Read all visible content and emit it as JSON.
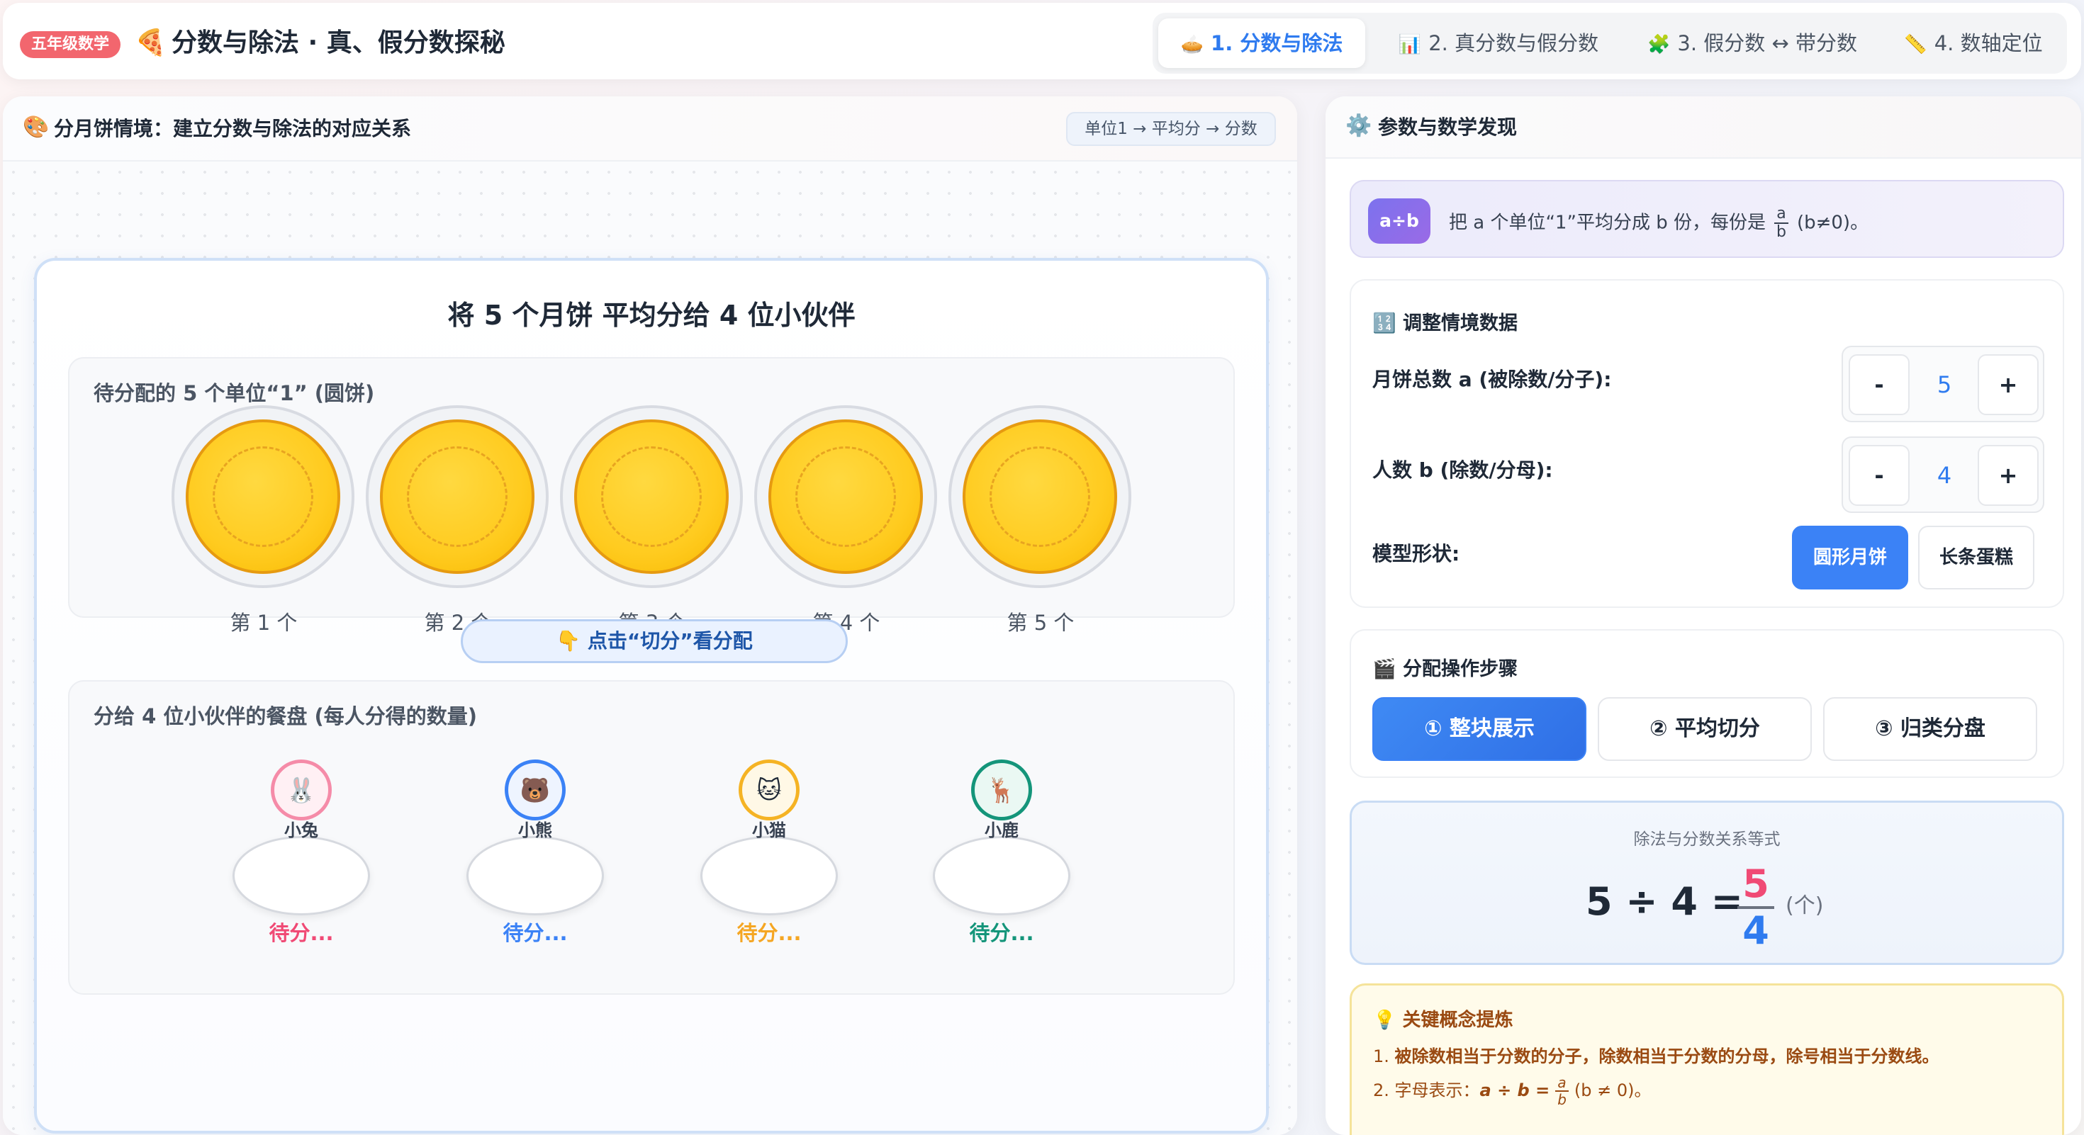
{
  "header": {
    "grade_badge": "五年级数学",
    "title_icon": "pizza-icon",
    "title": "分数与除法 · 真、假分数探秘",
    "tabs": [
      {
        "icon": "🥧",
        "label": "1. 分数与除法",
        "active": true
      },
      {
        "icon": "📊",
        "label": "2. 真分数与假分数",
        "active": false
      },
      {
        "icon": "🧩",
        "label": "3. 假分数 ↔ 带分数",
        "active": false
      },
      {
        "icon": "📏",
        "label": "4. 数轴定位",
        "active": false
      }
    ]
  },
  "scene": {
    "header_icon": "palette-icon",
    "header_title": "分月饼情境：建立分数与除法的对应关系",
    "flow_chip": "单位1 → 平均分 → 分数",
    "title": "将 5 个月饼 平均分给 4 位小伙伴",
    "pool_label": "待分配的 5 个单位“1” (圆饼)",
    "cakes": [
      "第 1 个",
      "第 2 个",
      "第 3 个",
      "第 4 个",
      "第 5 个"
    ],
    "cut_button": "👇 点击“切分”看分配",
    "plates_label": "分给 4 位小伙伴的餐盘 (每人分得的数量)",
    "friends": [
      {
        "emoji": "🐰",
        "name": "小兔",
        "status": "待分...",
        "color": "#f04a75"
      },
      {
        "emoji": "🐻",
        "name": "小熊",
        "status": "待分...",
        "color": "#3b82f6"
      },
      {
        "emoji": "🐱",
        "name": "小猫",
        "status": "待分...",
        "color": "#f5a623"
      },
      {
        "emoji": "🦌",
        "name": "小鹿",
        "status": "待分...",
        "color": "#14957a"
      }
    ]
  },
  "panel": {
    "header_icon": "gear-icon",
    "header_title": "参数与数学发现",
    "rule_badge": "a÷b",
    "rule_prefix": "把 a 个单位“1”平均分成 b 份，每份是",
    "rule_frac_num": "a",
    "rule_frac_den": "b",
    "rule_suffix": "(b≠0)。",
    "adjust_icon": "🔢",
    "adjust_title": "调整情境数据",
    "total_label": "月饼总数 a (被除数/分子):",
    "total_value": "5",
    "people_label": "人数 b (除数/分母):",
    "people_value": "4",
    "minus": "-",
    "plus": "+",
    "shape_label": "模型形状:",
    "shape_options": [
      "圆形月饼",
      "长条蛋糕"
    ],
    "steps_icon": "🎬",
    "steps_title": "分配操作步骤",
    "steps": [
      "① 整块展示",
      "② 平均切分",
      "③ 归类分盘"
    ],
    "equation": {
      "caption": "除法与分数关系等式",
      "lhs": "5 ÷ 4 =",
      "numerator": "5",
      "denominator": "4",
      "unit": "(个)"
    },
    "concept": {
      "icon": "💡",
      "title": "关键概念提炼",
      "line1_prefix": "1. ",
      "line1": "被除数相当于分数的分子，除数相当于分数的分母，除号相当于分数线。",
      "line2_prefix": "2. 字母表示：",
      "line2_expr": "a ÷ b =",
      "line2_num": "a",
      "line2_den": "b",
      "line2_suffix": "(b ≠ 0)。"
    }
  }
}
